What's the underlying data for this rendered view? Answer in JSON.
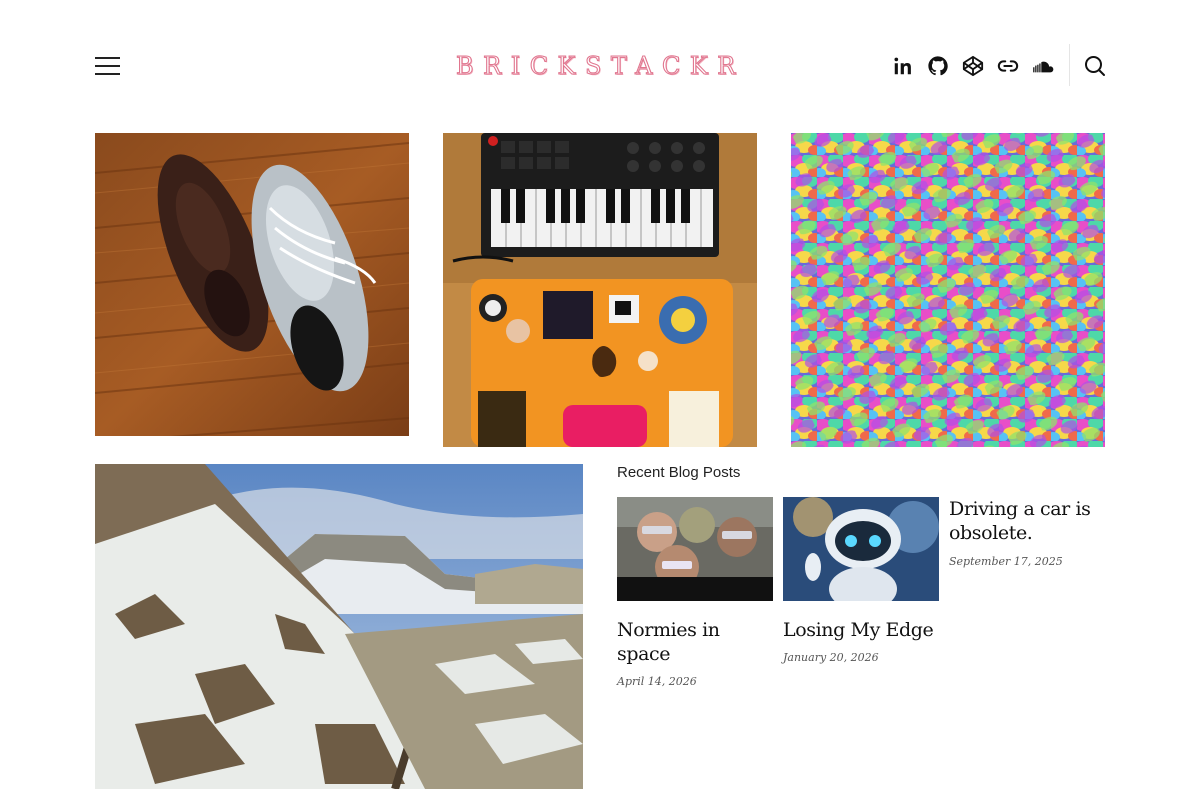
{
  "header": {
    "logo_text": "BRICKSTACKR",
    "menu_icon": "hamburger-menu-icon",
    "social_icons": [
      "linkedin-icon",
      "github-icon",
      "codepen-icon",
      "link-icon",
      "soundcloud-icon"
    ],
    "search_icon": "search-icon"
  },
  "gallery": {
    "items": [
      {
        "icon": "photo-sneakers"
      },
      {
        "icon": "photo-midi-keyboard-laptop"
      },
      {
        "icon": "photo-colorful-mosaic"
      },
      {
        "icon": "photo-snowy-mountain"
      }
    ]
  },
  "recent_posts": {
    "heading": "Recent Blog Posts",
    "posts": [
      {
        "title": "Normies in space",
        "date": "April 14, 2026"
      },
      {
        "title": "Losing My Edge",
        "date": "January 20, 2026"
      },
      {
        "title": "Driving a car is obsolete.",
        "date": "September 17, 2025"
      }
    ]
  },
  "colors": {
    "logo_accent": "#e1768f",
    "text": "#111111",
    "background": "#ffffff"
  }
}
